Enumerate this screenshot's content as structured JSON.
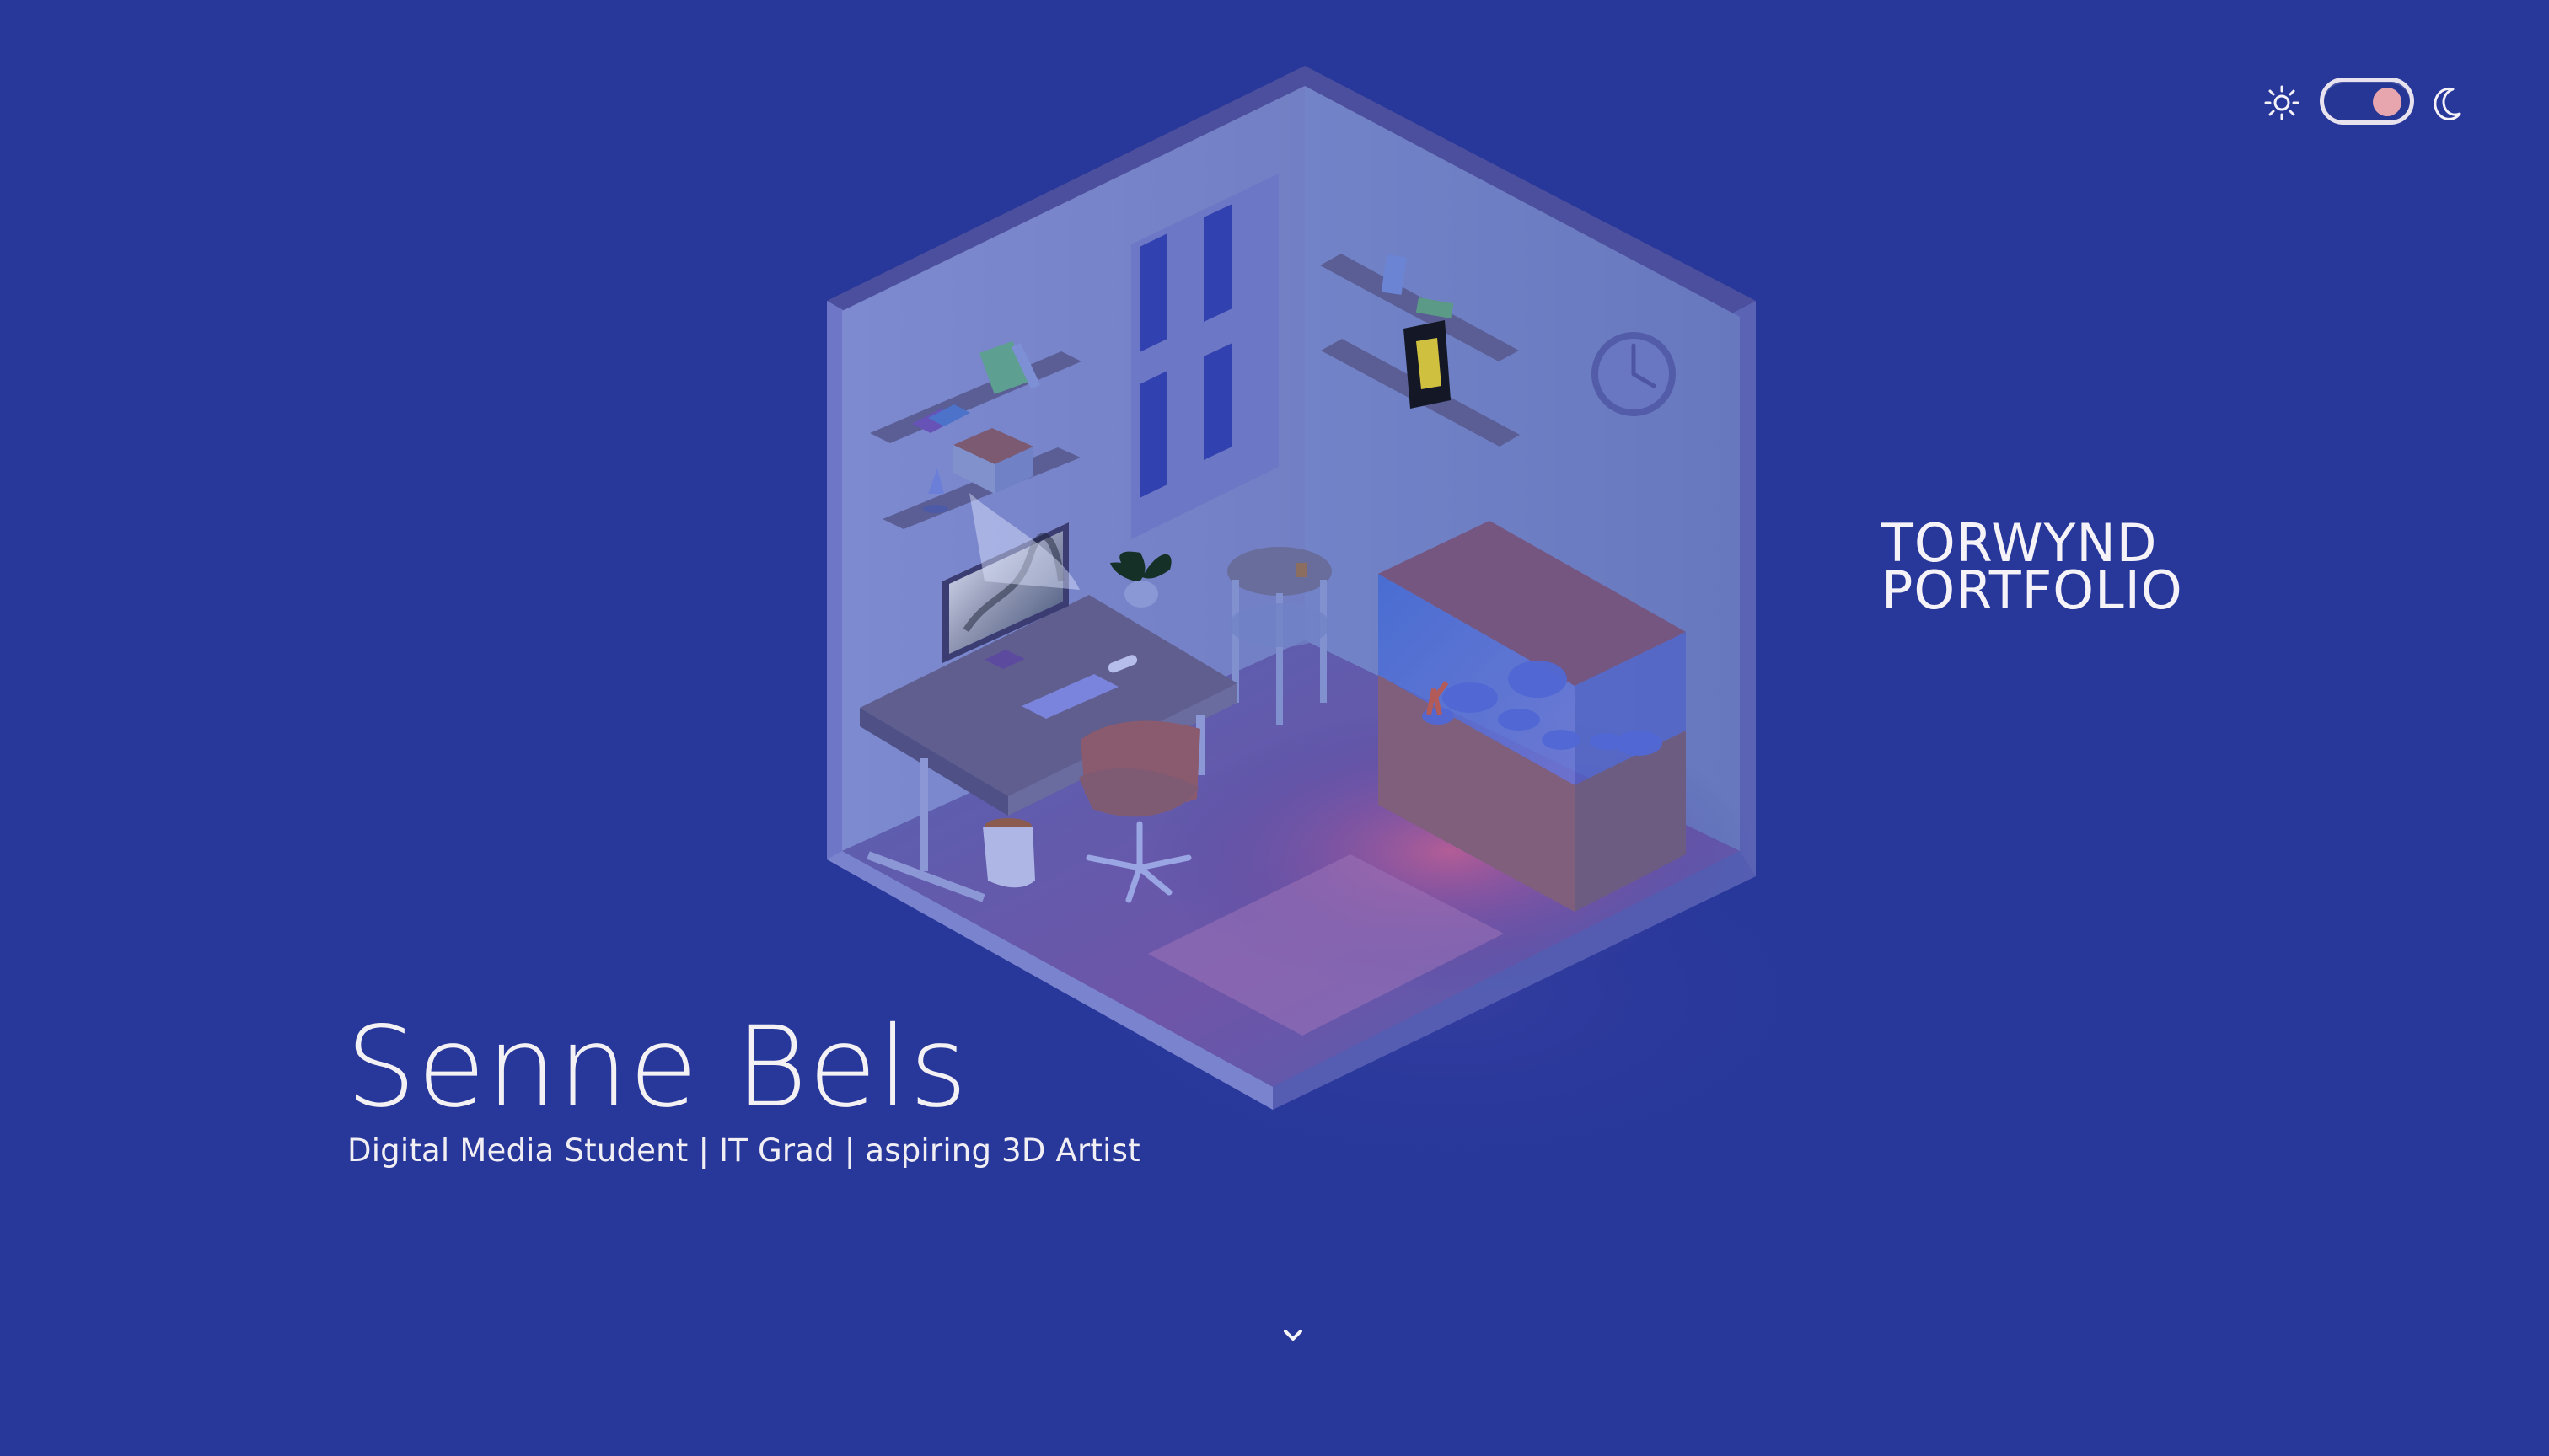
{
  "hero": {
    "name": "Senne Bels",
    "subtitle": "Digital Media Student | IT Grad | aspiring 3D Artist"
  },
  "brand": {
    "line1": "TORWYND",
    "line2": "PORTFOLIO"
  },
  "theme_toggle": {
    "light_icon": "sun-icon",
    "dark_icon": "moon-icon",
    "state": "dark"
  },
  "scroll": {
    "icon": "chevron-down-icon"
  },
  "scene": {
    "type": "isometric-room",
    "objects": [
      "desk",
      "monitor",
      "keyboard",
      "chair",
      "shelves",
      "plant",
      "window",
      "clock",
      "aquarium",
      "side-table",
      "rug",
      "wastebasket",
      "lamp"
    ]
  },
  "colors": {
    "background": "#27379a",
    "text": "#f4f1f4",
    "toggle_knob": "#e7a6ae",
    "accent_glow": "#c56a9a"
  }
}
